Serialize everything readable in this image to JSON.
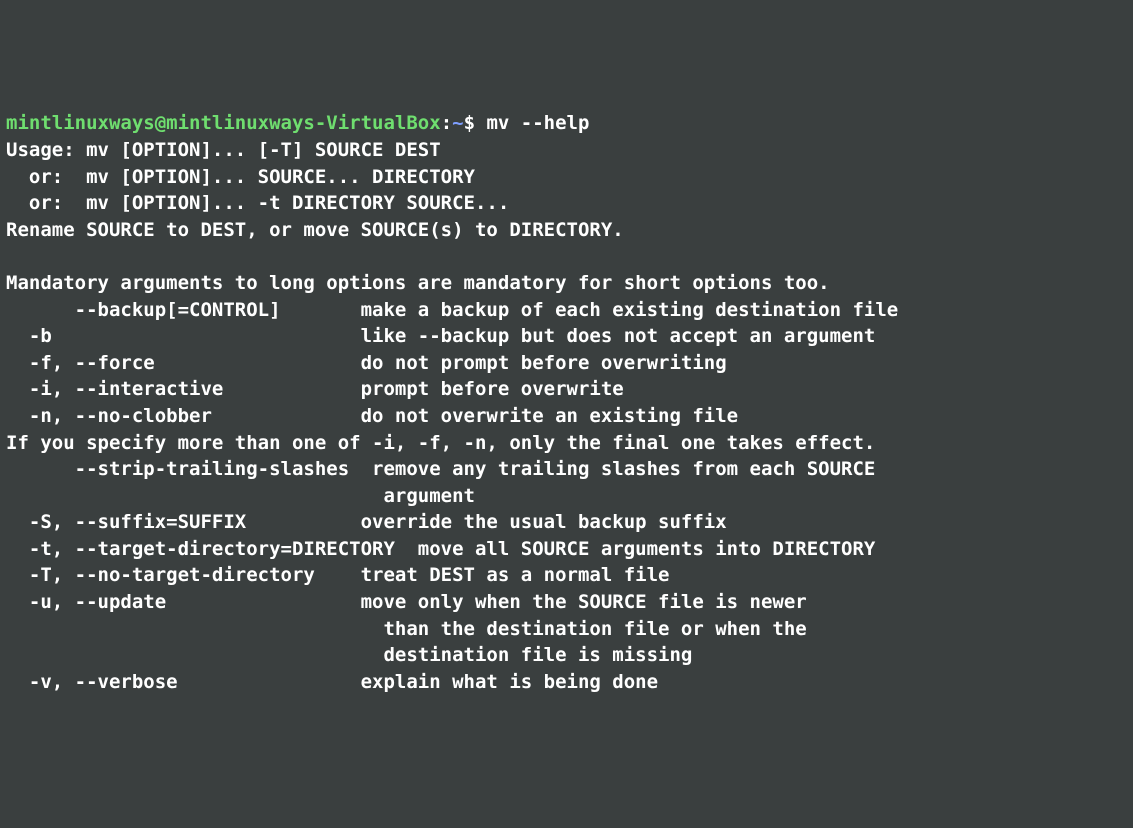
{
  "prompt": {
    "user_host": "mintlinuxways@mintlinuxways-VirtualBox",
    "separator": ":",
    "path": "~",
    "dollar": "$ "
  },
  "command": "mv --help",
  "output_lines": [
    "Usage: mv [OPTION]... [-T] SOURCE DEST",
    "  or:  mv [OPTION]... SOURCE... DIRECTORY",
    "  or:  mv [OPTION]... -t DIRECTORY SOURCE...",
    "Rename SOURCE to DEST, or move SOURCE(s) to DIRECTORY.",
    "",
    "Mandatory arguments to long options are mandatory for short options too.",
    "      --backup[=CONTROL]       make a backup of each existing destination file",
    "  -b                           like --backup but does not accept an argument",
    "  -f, --force                  do not prompt before overwriting",
    "  -i, --interactive            prompt before overwrite",
    "  -n, --no-clobber             do not overwrite an existing file",
    "If you specify more than one of -i, -f, -n, only the final one takes effect.",
    "      --strip-trailing-slashes  remove any trailing slashes from each SOURCE",
    "                                 argument",
    "  -S, --suffix=SUFFIX          override the usual backup suffix",
    "  -t, --target-directory=DIRECTORY  move all SOURCE arguments into DIRECTORY",
    "  -T, --no-target-directory    treat DEST as a normal file",
    "  -u, --update                 move only when the SOURCE file is newer",
    "                                 than the destination file or when the",
    "                                 destination file is missing",
    "  -v, --verbose                explain what is being done"
  ]
}
